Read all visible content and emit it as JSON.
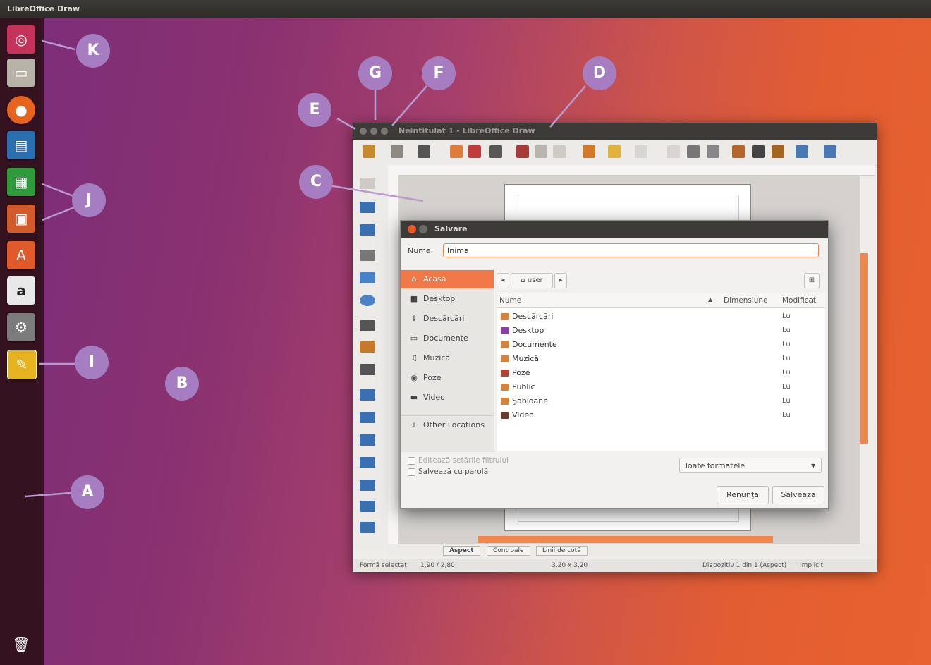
{
  "topbar": {
    "title": "LibreOffice Draw"
  },
  "launcher": {
    "items": [
      {
        "name": "ubuntu-dash-icon",
        "color": "#c5325a"
      },
      {
        "name": "files-icon",
        "color": "#b8b3a8"
      },
      {
        "name": "firefox-icon",
        "color": "#e7641f"
      },
      {
        "name": "writer-icon",
        "color": "#2a6fb0"
      },
      {
        "name": "calc-icon",
        "color": "#2f9a3c"
      },
      {
        "name": "impress-icon",
        "color": "#d35a2a"
      },
      {
        "name": "software-center-icon",
        "color": "#e05a2b"
      },
      {
        "name": "amazon-icon",
        "color": "#e8e8e8"
      },
      {
        "name": "system-settings-icon",
        "color": "#7b7b7b"
      },
      {
        "name": "draw-icon",
        "color": "#e7b21f"
      }
    ],
    "trash": "trash-icon"
  },
  "window": {
    "title": "Neintitulat 1 - LibreOffice Draw",
    "tabs": [
      "Aspect",
      "Controale",
      "Linii de cotă"
    ],
    "status": {
      "selection": "Formă selectat",
      "position": "1,90 / 2,80",
      "size": "3,20 x 3,20",
      "slide": "Diapozitiv 1 din 1 (Aspect)",
      "layout": "Implicit"
    }
  },
  "dialog": {
    "title": "Salvare",
    "name_label": "Nume:",
    "name_value": "Inima",
    "places": [
      {
        "label": "Acasă",
        "icon": "⌂",
        "active": true
      },
      {
        "label": "Desktop",
        "icon": "■"
      },
      {
        "label": "Descărcări",
        "icon": "↓"
      },
      {
        "label": "Documente",
        "icon": "▭"
      },
      {
        "label": "Muzică",
        "icon": "♫"
      },
      {
        "label": "Poze",
        "icon": "◉"
      },
      {
        "label": "Video",
        "icon": "▬"
      }
    ],
    "other_locations": "Other Locations",
    "path": "user",
    "columns": {
      "name": "Nume",
      "size": "Dimensiune",
      "modified": "Modificat"
    },
    "files": [
      {
        "name": "Descărcări",
        "modified": "Lu",
        "color": "#d6823a"
      },
      {
        "name": "Desktop",
        "modified": "Lu",
        "color": "#8a3fa6"
      },
      {
        "name": "Documente",
        "modified": "Lu",
        "color": "#d6823a"
      },
      {
        "name": "Muzică",
        "modified": "Lu",
        "color": "#d6823a"
      },
      {
        "name": "Poze",
        "modified": "Lu",
        "color": "#b0432f"
      },
      {
        "name": "Public",
        "modified": "Lu",
        "color": "#d6823a"
      },
      {
        "name": "Şabloane",
        "modified": "Lu",
        "color": "#d6823a"
      },
      {
        "name": "Video",
        "modified": "Lu",
        "color": "#6b3a2a"
      }
    ],
    "option_filter": "Editează setările filtrului",
    "option_password": "Salvează cu parolă",
    "file_type": "Toate formatele",
    "cancel": "Renunţă",
    "save": "Salvează"
  },
  "callouts": [
    "A",
    "B",
    "C",
    "D",
    "E",
    "F",
    "G",
    "I",
    "J",
    "K"
  ]
}
